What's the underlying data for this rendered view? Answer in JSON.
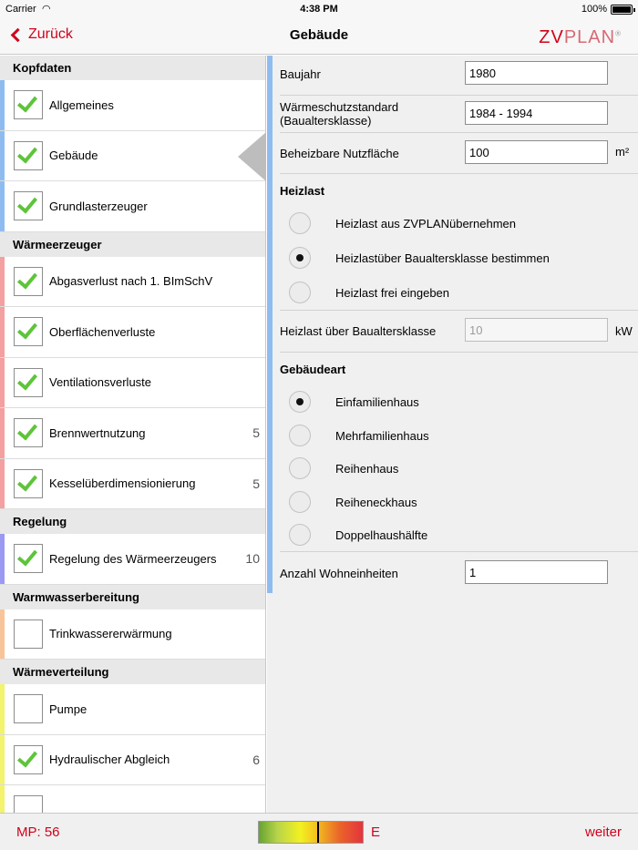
{
  "status": {
    "carrier": "Carrier",
    "wifi_icon": "wifi-icon",
    "time": "4:38 PM",
    "battery_pct": "100%",
    "battery_level": 1.0
  },
  "nav": {
    "back_label": "Zurück",
    "title": "Gebäude",
    "logo_zv": "ZV",
    "logo_plan": "PLAN",
    "logo_reg": "®",
    "accent": "#d0021b"
  },
  "sidebar": {
    "sections": [
      {
        "header": "Kopfdaten",
        "color": "#8fbcf0",
        "items": [
          {
            "label": "Allgemeines",
            "checked": true,
            "count": ""
          },
          {
            "label": "Gebäude",
            "checked": true,
            "count": "",
            "selected": true
          },
          {
            "label": "Grundlasterzeuger",
            "checked": true,
            "count": ""
          }
        ]
      },
      {
        "header": "Wärmeerzeuger",
        "color": "#f4a0a0",
        "items": [
          {
            "label": "Abgasverlust nach 1. BImSchV",
            "checked": true,
            "count": ""
          },
          {
            "label": "Oberflächenverluste",
            "checked": true,
            "count": ""
          },
          {
            "label": "Ventilationsverluste",
            "checked": true,
            "count": ""
          },
          {
            "label": "Brennwertnutzung",
            "checked": true,
            "count": "5"
          },
          {
            "label": "Kesselüberdimensionierung",
            "checked": true,
            "count": "5"
          }
        ]
      },
      {
        "header": "Regelung",
        "color": "#9a9af2",
        "items": [
          {
            "label": "Regelung des Wärmeerzeugers",
            "checked": true,
            "count": "10"
          }
        ]
      },
      {
        "header": "Warmwasserbereitung",
        "color": "#f8c49a",
        "items": [
          {
            "label": "Trinkwassererwärmung",
            "checked": false,
            "count": ""
          }
        ]
      },
      {
        "header": "Wärmeverteilung",
        "color": "#f3f36e",
        "items": [
          {
            "label": "Pumpe",
            "checked": false,
            "count": ""
          },
          {
            "label": "Hydraulischer Abgleich",
            "checked": true,
            "count": "6"
          },
          {
            "label": "",
            "checked": false,
            "count": ""
          }
        ]
      }
    ]
  },
  "form": {
    "baujahr_label": "Baujahr",
    "baujahr_value": "1980",
    "standard_label_1": "Wärmeschutzstandard",
    "standard_label_2": "(Baualtersklasse)",
    "standard_value": "1984 - 1994",
    "nutzflaeche_label": "Beheizbare Nutzfläche",
    "nutzflaeche_value": "100",
    "nutzflaeche_unit": "m²",
    "heizlast_title": "Heizlast",
    "heizlast_options": [
      {
        "label": "Heizlast aus ZVPLANübernehmen",
        "selected": false
      },
      {
        "label": "Heizlastüber Baualtersklasse bestimmen",
        "selected": true
      },
      {
        "label": "Heizlast frei eingeben",
        "selected": false
      }
    ],
    "heizlast_bak_label": "Heizlast über Baualtersklasse",
    "heizlast_bak_value": "10",
    "heizlast_bak_unit": "kW",
    "gebaeudeart_title": "Gebäudeart",
    "gebaeudeart_options": [
      {
        "label": "Einfamilienhaus",
        "selected": true
      },
      {
        "label": "Mehrfamilienhaus",
        "selected": false
      },
      {
        "label": "Reihenhaus",
        "selected": false
      },
      {
        "label": "Reiheneckhaus",
        "selected": false
      },
      {
        "label": "Doppelhaushälfte",
        "selected": false
      }
    ],
    "wohneinheiten_label": "Anzahl Wohneinheiten",
    "wohneinheiten_value": "1"
  },
  "footer": {
    "mp": "MP: 56",
    "gauge_level": 0.56,
    "grade": "E",
    "next_label": "weiter"
  }
}
